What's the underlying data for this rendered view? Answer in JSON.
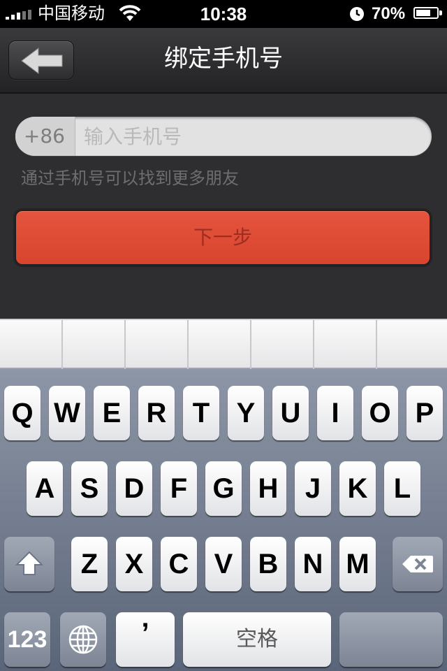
{
  "status_bar": {
    "carrier": "中国移动",
    "time": "10:38",
    "battery_percent": "70%",
    "battery_level": 0.7,
    "icons": [
      "signal-icon",
      "wifi-icon",
      "alarm-icon",
      "battery-icon"
    ]
  },
  "nav": {
    "title": "绑定手机号",
    "back_icon": "back-arrow-icon"
  },
  "form": {
    "country_code": "+86",
    "phone_placeholder": "输入手机号",
    "phone_value": "",
    "hint": "通过手机号可以找到更多朋友",
    "next_label": "下一步"
  },
  "keyboard": {
    "row1": [
      "Q",
      "W",
      "E",
      "R",
      "T",
      "Y",
      "U",
      "I",
      "O",
      "P"
    ],
    "row2": [
      "A",
      "S",
      "D",
      "F",
      "G",
      "H",
      "J",
      "K",
      "L"
    ],
    "row3": [
      "Z",
      "X",
      "C",
      "V",
      "B",
      "N",
      "M"
    ],
    "numbers_label": "123",
    "apostrophe_label": "’",
    "space_label": "空格",
    "shift_icon": "shift-icon",
    "delete_icon": "delete-icon",
    "globe_icon": "globe-icon"
  },
  "colors": {
    "accent_red": "#e14f3a",
    "nav_dark": "#2b2b2d"
  }
}
